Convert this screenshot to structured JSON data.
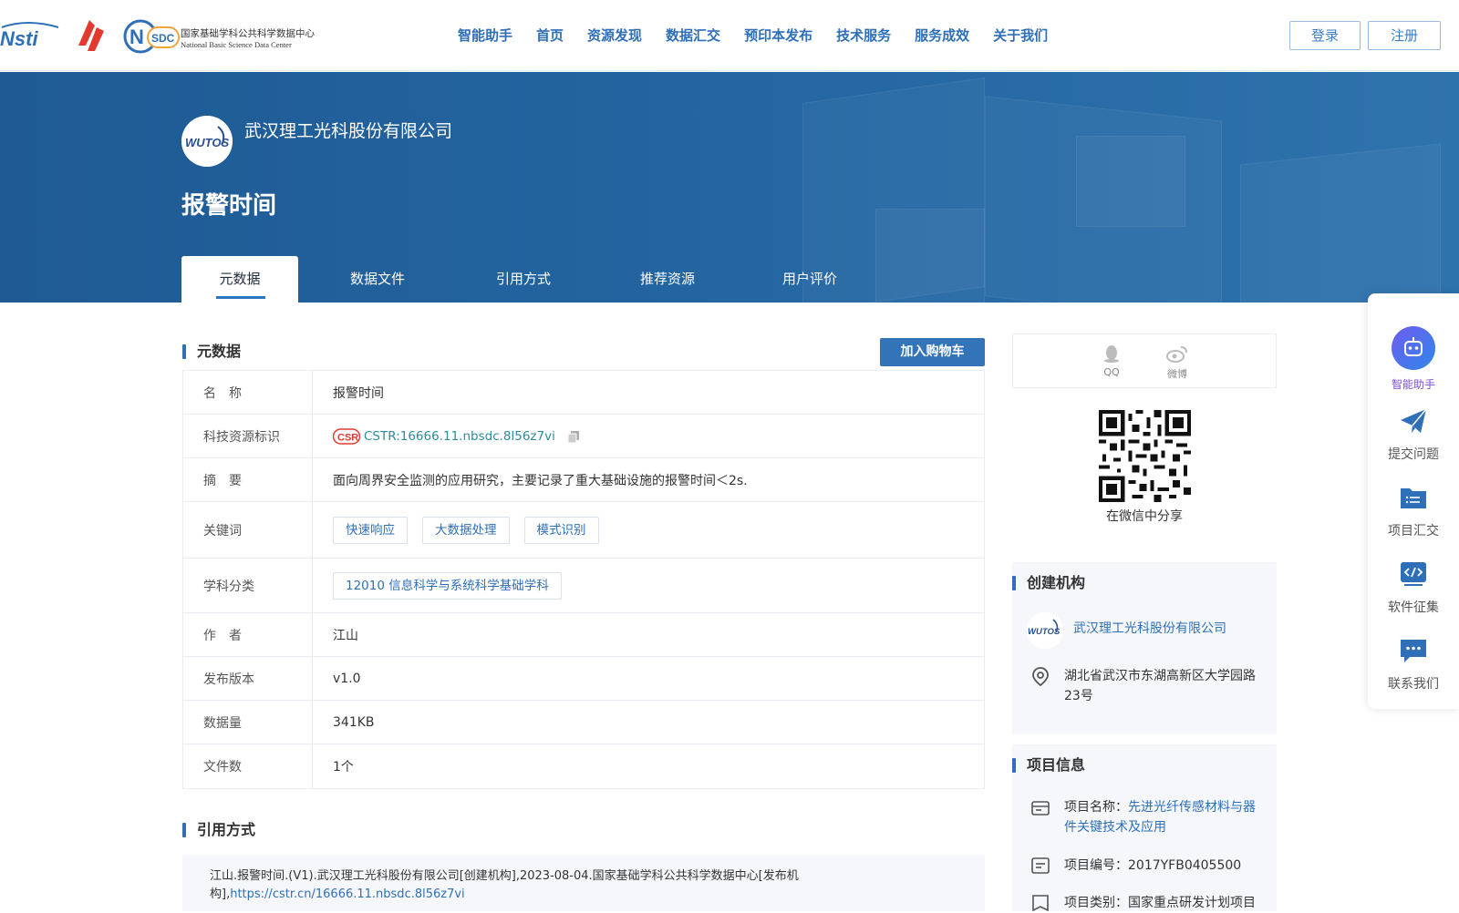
{
  "header": {
    "nav": [
      "智能助手",
      "首页",
      "资源发现",
      "数据汇交",
      "预印本发布",
      "技术服务",
      "服务成效",
      "关于我们"
    ],
    "login": "登录",
    "register": "注册",
    "logo_nsdc_line1": "国家基础学科公共科学数据中心",
    "logo_nsdc_line2": "National Basic Science Data Center"
  },
  "banner": {
    "org_name": "武汉理工光科股份有限公司",
    "title": "报警时间",
    "tabs": [
      "元数据",
      "数据文件",
      "引用方式",
      "推荐资源",
      "用户评价"
    ]
  },
  "metadata": {
    "section_title": "元数据",
    "cart_button": "加入购物车",
    "rows": {
      "name_label": "名　称",
      "name_value": "报警时间",
      "id_label": "科技资源标识",
      "id_value": "CSTR:16666.11.nbsdc.8l56z7vi",
      "abstract_label": "摘　要",
      "abstract_value": "面向周界安全监测的应用研究，主要记录了重大基础设施的报警时间＜2s.",
      "keywords_label": "关键词",
      "keywords": [
        "快速响应",
        "大数据处理",
        "模式识别"
      ],
      "subject_label": "学科分类",
      "subject_value": "12010 信息科学与系统科学基础学科",
      "author_label": "作　者",
      "author_value": "江山",
      "version_label": "发布版本",
      "version_value": "v1.0",
      "size_label": "数据量",
      "size_value": "341KB",
      "files_label": "文件数",
      "files_value": "1个"
    }
  },
  "citation": {
    "section_title": "引用方式",
    "text": "江山.报警时间.(V1).武汉理工光科股份有限公司[创建机构],2023-08-04.国家基础学科公共科学数据中心[发布机构],",
    "link": "https://cstr.cn/16666.11.nbsdc.8l56z7vi"
  },
  "share": {
    "qq": "QQ",
    "weibo": "微博",
    "wechat": "在微信中分享"
  },
  "institution": {
    "section_title": "创建机构",
    "name": "武汉理工光科股份有限公司",
    "address": "湖北省武汉市东湖高新区大学园路23号"
  },
  "project": {
    "section_title": "项目信息",
    "name_label": "项目名称：",
    "name_value": "先进光纤传感材料与器件关键技术及应用",
    "code": "项目编号：2017YFB0405500",
    "type": "项目类别：国家重点研发计划项目"
  },
  "float_bar": {
    "assistant": "智能助手",
    "submit": "提交问题",
    "collect": "项目汇交",
    "software": "软件征集",
    "contact": "联系我们"
  },
  "colors": {
    "primary": "#2f6fb8",
    "banner": "#2467a3",
    "accent": "#7b4ddb"
  }
}
